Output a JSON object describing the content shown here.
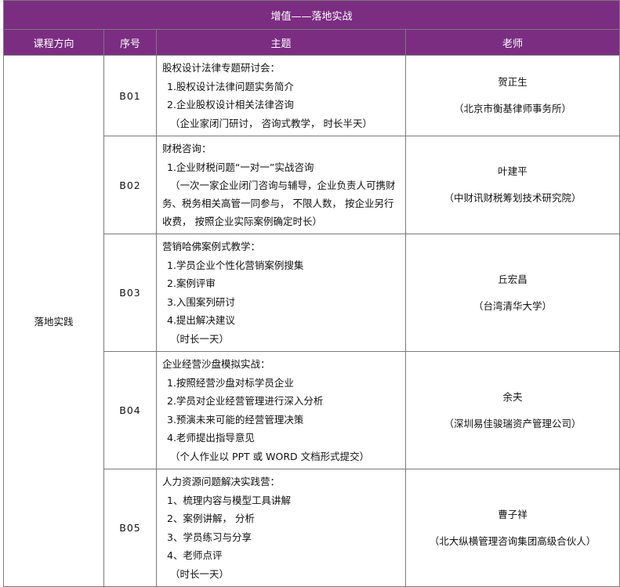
{
  "table_title": "增值——落地实战",
  "headers": {
    "direction": "课程方向",
    "number": "序号",
    "topic": "主题",
    "teacher": "老师"
  },
  "direction": "落地实践",
  "rows": [
    {
      "code": "B01",
      "topic": {
        "heading": "股权设计法律专题研讨会：",
        "lines": [
          "1.股权设计法律问题实务简介",
          "2.企业股权设计相关法律咨询",
          "（企业家闭门研讨，  咨询式教学，  时长半天）"
        ]
      },
      "teacher": {
        "name": "贺正生",
        "org": "（北京市衡基律师事务所）"
      }
    },
    {
      "code": "B02",
      "topic": {
        "heading": "财税咨询：",
        "lines": [
          "1.企业财税问题“一对一”实战咨询",
          "（一次一家企业闭门咨询与辅导，企业负责人可携财务、税务相关高管一同参与，  不限人数，  按企业另行收费，  按照企业实际案例确定时长）"
        ]
      },
      "teacher": {
        "name": "叶建平",
        "org": "（中财讯财税筹划技术研究院）"
      }
    },
    {
      "code": "B03",
      "topic": {
        "heading": "营销哈佛案例式教学：",
        "lines": [
          "1.学员企业个性化营销案例搜集",
          "2.案例评审",
          "3.入围案列研讨",
          "4.提出解决建议",
          "（时长一天）"
        ]
      },
      "teacher": {
        "name": "丘宏昌",
        "org": "（台湾清华大学）"
      }
    },
    {
      "code": "B04",
      "topic": {
        "heading": "企业经营沙盘模拟实战：",
        "lines": [
          "1.按照经营沙盘对标学员企业",
          "2.学员对企业经营管理进行深入分析",
          "3.预演未来可能的经营管理决策",
          "4.老师提出指导意见",
          "（个人作业以 PPT 或 WORD 文档形式提交）"
        ]
      },
      "teacher": {
        "name": "余夫",
        "org": "（深圳易佳骏瑞资产管理公司）"
      }
    },
    {
      "code": "B05",
      "topic": {
        "heading": "人力资源问题解决实践营：",
        "lines": [
          "1、梳理内容与模型工具讲解",
          "2、案例讲解，   分析",
          "3、学员练习与分享",
          "4、老师点评",
          "（时长一天）"
        ]
      },
      "teacher": {
        "name": "曹子祥",
        "org": "（北大纵横管理咨询集团高级合伙人）"
      }
    }
  ]
}
